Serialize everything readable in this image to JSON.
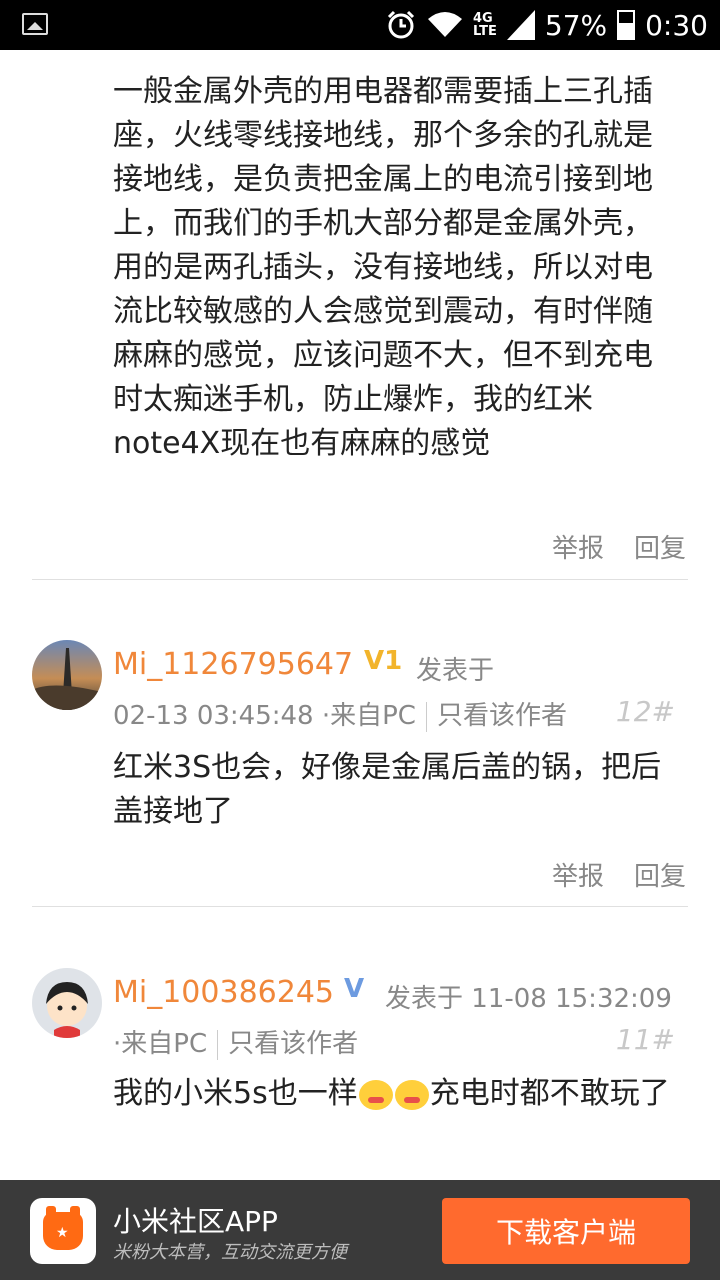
{
  "status_bar": {
    "network_top": "4G",
    "network_bottom": "LTE",
    "battery": "57%",
    "time": "0:30"
  },
  "posts": [
    {
      "text": "一般金属外壳的用电器都需要插上三孔插座，火线零线接地线，那个多余的孔就是接地线，是负责把金属上的电流引接到地上，而我们的手机大部分都是金属外壳，用的是两孔插头，没有接地线，所以对电流比较敏感的人会感觉到震动，有时伴随麻麻的感觉，应该问题不大，但不到充电时太痴迷手机，防止爆炸，我的红米note4X现在也有麻麻的感觉",
      "report": "举报",
      "reply": "回复"
    },
    {
      "username": "Mi_1126795647",
      "badge": "V1",
      "posted_at_label": "发表于",
      "datetime": "02-13 03:45:48",
      "source": "·来自PC",
      "only_author": "只看该作者",
      "floor": "12#",
      "text": "红米3S也会，好像是金属后盖的锅，把后盖接地了",
      "report": "举报",
      "reply": "回复"
    },
    {
      "username": "Mi_100386245",
      "badge": "V",
      "posted_at_label": "发表于",
      "datetime": "11-08 15:32:09",
      "source": "·来自PC",
      "only_author": "只看该作者",
      "floor": "11#",
      "text_before": "我的小米5s也一样",
      "text_after": "充电时都不敢玩了"
    }
  ],
  "banner": {
    "app_name": "小米社区APP",
    "slogan": "米粉大本营，互动交流更方便",
    "download": "下载客户端"
  }
}
